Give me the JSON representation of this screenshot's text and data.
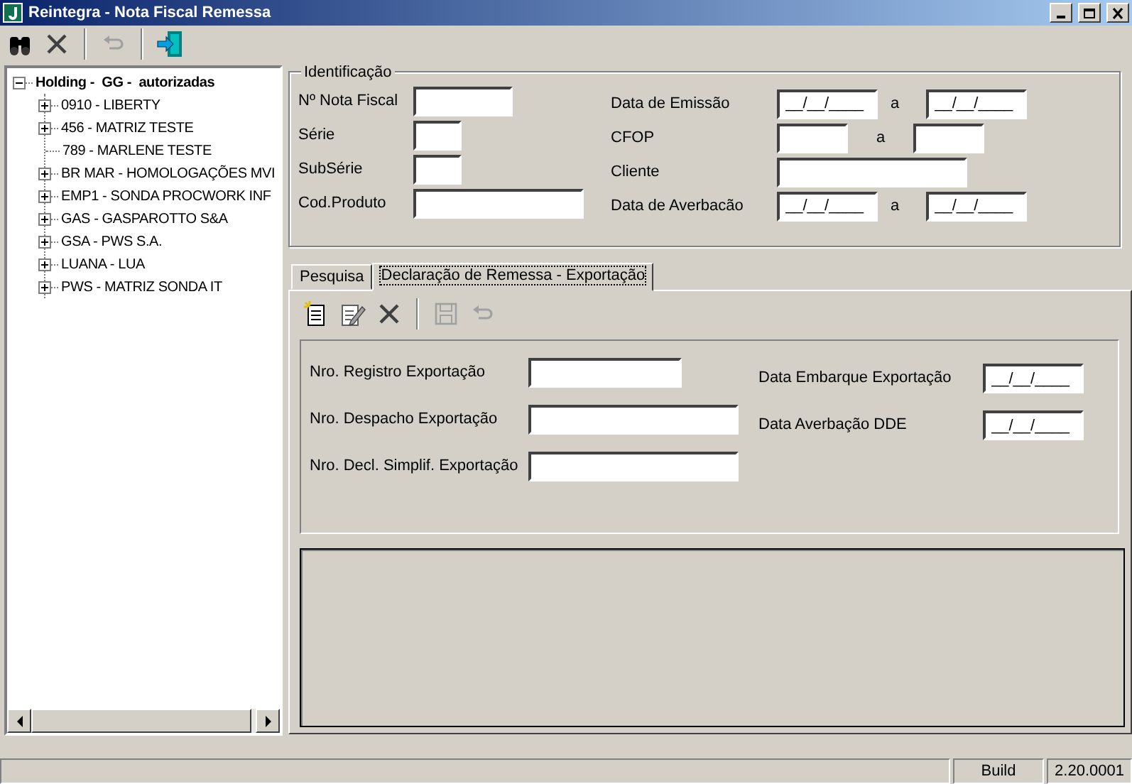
{
  "window": {
    "title": "Reintegra - Nota Fiscal Remessa"
  },
  "toolbar": [
    {
      "kind": "search",
      "disabled": false
    },
    {
      "kind": "delete",
      "disabled": false
    },
    {
      "kind": "separator"
    },
    {
      "kind": "undo",
      "disabled": true
    },
    {
      "kind": "separator"
    },
    {
      "kind": "exit",
      "disabled": false
    }
  ],
  "tree": {
    "label": "Holding -  GG -  autorizadas",
    "kind": "branch",
    "expanded": true,
    "children": [
      {
        "label": "0910 - LIBERTY",
        "kind": "branch",
        "expanded": false
      },
      {
        "label": "456 - MATRIZ TESTE",
        "kind": "branch",
        "expanded": false
      },
      {
        "label": "789 - MARLENE TESTE",
        "kind": "leaf"
      },
      {
        "label": "BR MAR - HOMOLOGAÇÕES MVI",
        "kind": "branch",
        "expanded": false
      },
      {
        "label": "EMP1 - SONDA PROCWORK INF",
        "kind": "branch",
        "expanded": false
      },
      {
        "label": "GAS - GASPAROTTO S&A",
        "kind": "branch",
        "expanded": false
      },
      {
        "label": "GSA - PWS S.A.",
        "kind": "branch",
        "expanded": false
      },
      {
        "label": "LUANA - LUA",
        "kind": "branch",
        "expanded": false
      },
      {
        "label": "PWS - MATRIZ SONDA IT",
        "kind": "branch",
        "expanded": false
      }
    ]
  },
  "identificacao": {
    "title": "Identificação",
    "left_fields": [
      {
        "label": "Nº Nota Fiscal",
        "kind": "medium"
      },
      {
        "label": "Série",
        "kind": "tiny"
      },
      {
        "label": "SubSérie",
        "kind": "tiny"
      },
      {
        "label": "Cod.Produto",
        "kind": "long"
      }
    ],
    "right_fields": [
      {
        "label": "Data de Emissão",
        "kind": "date_range",
        "from_value": "__/__/____",
        "separator": "a",
        "to_value": "__/__/____"
      },
      {
        "label": "CFOP",
        "kind": "text_range",
        "separator": "a"
      },
      {
        "label": "Cliente",
        "kind": "text"
      },
      {
        "label": "Data de Averbacão",
        "kind": "date_range",
        "from_value": "__/__/____",
        "separator": "a",
        "to_value": "__/__/____"
      }
    ]
  },
  "tabs": [
    {
      "label": "Pesquisa",
      "selected": false
    },
    {
      "label": "Declaração de Remessa - Exportação",
      "selected": true
    }
  ],
  "tab_toolbar": [
    {
      "kind": "new",
      "disabled": false
    },
    {
      "kind": "edit",
      "disabled": false
    },
    {
      "kind": "delete",
      "disabled": false
    },
    {
      "kind": "separator"
    },
    {
      "kind": "save",
      "disabled": true
    },
    {
      "kind": "undo",
      "disabled": true
    }
  ],
  "export_form": {
    "left_fields": [
      {
        "label": "Nro. Registro Exportação",
        "kind": "medium"
      },
      {
        "label": "Nro. Despacho Exportação",
        "kind": "long"
      },
      {
        "label": "Nro. Decl. Simplif. Exportação",
        "kind": "long"
      }
    ],
    "right_fields": [
      {
        "label": "Data Embarque Exportação",
        "value": "__/__/____"
      },
      {
        "label": "Data Averbação DDE",
        "value": "__/__/____"
      }
    ]
  },
  "status_bar": {
    "build_label": "Build",
    "version": "2.20.0001"
  }
}
